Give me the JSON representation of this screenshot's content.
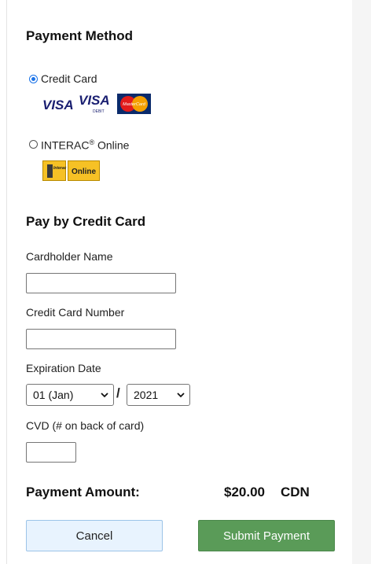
{
  "payment_method": {
    "heading": "Payment Method",
    "options": [
      {
        "label": "Credit Card",
        "selected": true,
        "logos": [
          "VISA",
          "VISA",
          "DEBIT",
          "MasterCard"
        ]
      },
      {
        "label": "INTERAC",
        "trademark": "®",
        "label_suffix": " Online",
        "selected": false,
        "logos": [
          "Interac",
          "Online"
        ]
      }
    ]
  },
  "credit_card": {
    "heading": "Pay by Credit Card",
    "cardholder_label": "Cardholder Name",
    "cardholder_value": "",
    "number_label": "Credit Card Number",
    "number_value": "",
    "expiration_label": "Expiration Date",
    "expiration_month": "01 (Jan)",
    "expiration_separator": "/",
    "expiration_year": "2021",
    "cvd_label": "CVD (# on back of card)",
    "cvd_value": ""
  },
  "amount": {
    "label": "Payment Amount:",
    "value": "$20.00",
    "currency": "CDN"
  },
  "buttons": {
    "cancel": "Cancel",
    "submit": "Submit Payment"
  },
  "colors": {
    "submit": "#5a9b58",
    "cancel": "#e8f3fe",
    "radio_selected": "#1a73e8",
    "visa_blue": "#1a1f71",
    "interac_gold": "#f6c125"
  }
}
